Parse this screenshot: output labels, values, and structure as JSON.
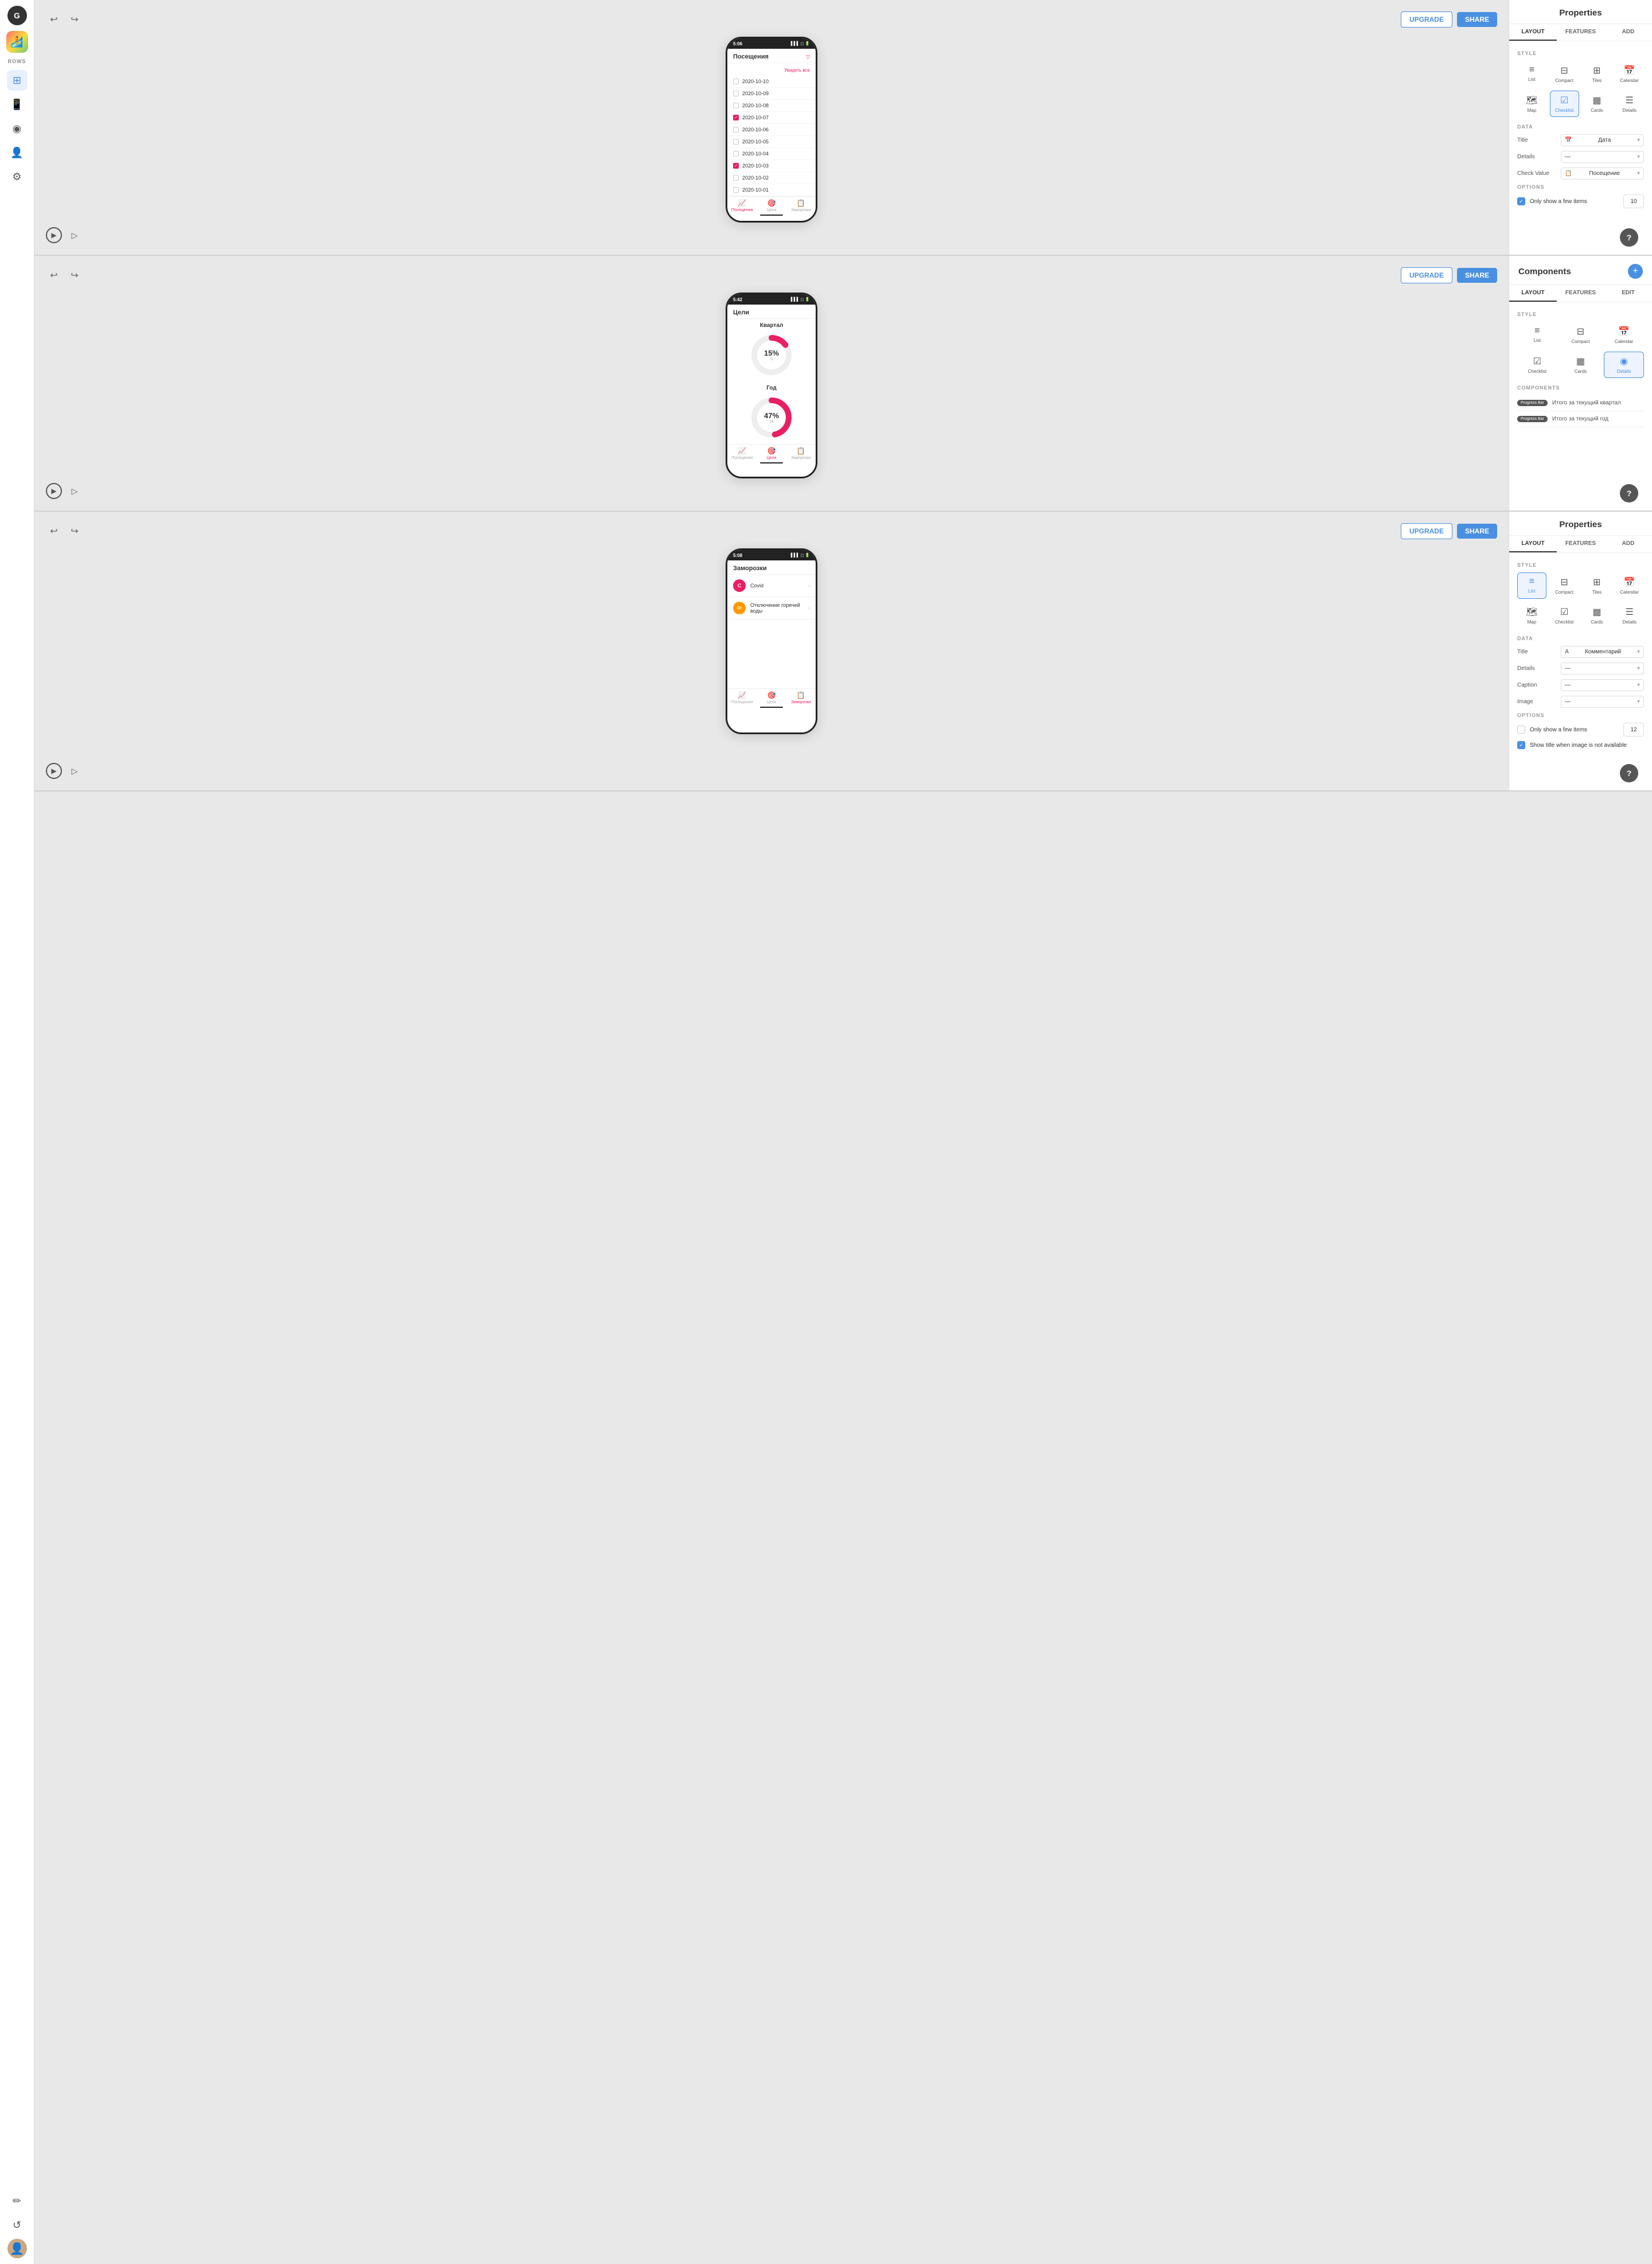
{
  "sidebar": {
    "avatar": "G",
    "app_icon": "🏄",
    "rows_label": "ROWS",
    "icons": [
      "⊞",
      "📱",
      "◉",
      "👤",
      "⚙",
      "✏",
      "↺"
    ],
    "user_icon": "👤"
  },
  "panel1": {
    "top_bar": {
      "undo": "↩",
      "redo": "↪",
      "upgrade": "UPGRADE",
      "share": "SHARE"
    },
    "phone": {
      "time": "5:06",
      "screen_title": "Посещения",
      "see_all": "Увидеть все",
      "filter_icon": "▽",
      "items": [
        {
          "date": "2020-10-10",
          "checked": false
        },
        {
          "date": "2020-10-09",
          "checked": false
        },
        {
          "date": "2020-10-08",
          "checked": false
        },
        {
          "date": "2020-10-07",
          "checked": true
        },
        {
          "date": "2020-10-06",
          "checked": false
        },
        {
          "date": "2020-10-05",
          "checked": false
        },
        {
          "date": "2020-10-04",
          "checked": false
        },
        {
          "date": "2020-10-03",
          "checked": true
        },
        {
          "date": "2020-10-02",
          "checked": false
        },
        {
          "date": "2020-10-01",
          "checked": false
        }
      ],
      "nav": [
        {
          "label": "Посещения",
          "icon": "📈",
          "active": true
        },
        {
          "label": "Цели",
          "icon": "🎯",
          "active": false
        },
        {
          "label": "Заморозки",
          "icon": "📋",
          "active": false
        }
      ]
    },
    "props": {
      "title": "Properties",
      "tabs": [
        "LAYOUT",
        "FEATURES",
        "ADD"
      ],
      "active_tab": "LAYOUT",
      "style_label": "STYLE",
      "styles": [
        {
          "icon": "≡",
          "label": "List"
        },
        {
          "icon": "⊟",
          "label": "Compact"
        },
        {
          "icon": "⊞",
          "label": "Tiles"
        },
        {
          "icon": "📅",
          "label": "Calendar"
        },
        {
          "icon": "🗺",
          "label": "Map"
        },
        {
          "icon": "☑",
          "label": "Checklist",
          "selected": true
        },
        {
          "icon": "▦",
          "label": "Cards"
        },
        {
          "icon": "☰",
          "label": "Details"
        }
      ],
      "data_label": "DATA",
      "fields": [
        {
          "label": "Title",
          "value": "Дата",
          "icon": "📅"
        },
        {
          "label": "Details",
          "value": "—"
        },
        {
          "label": "Check Value",
          "value": "Посещение",
          "icon": "📋"
        }
      ],
      "options_label": "OPTIONS",
      "only_show_few": {
        "label": "Only show a few items",
        "checked": true,
        "value": "10"
      }
    }
  },
  "panel2": {
    "top_bar": {
      "upgrade": "UPGRADE",
      "share": "SHARE"
    },
    "phone": {
      "time": "5:42",
      "screen_title": "Цели",
      "sections": [
        {
          "period": "Квартал",
          "pct": "15%",
          "num": "3",
          "arc": 15
        },
        {
          "period": "Год",
          "pct": "47%",
          "num": "24",
          "arc": 47
        }
      ],
      "nav": [
        {
          "label": "Посещения",
          "icon": "📈",
          "active": false
        },
        {
          "label": "Цели",
          "icon": "🎯",
          "active": true
        },
        {
          "label": "Заморозки",
          "icon": "📋",
          "active": false
        }
      ]
    },
    "props": {
      "title": "Components",
      "tabs": [
        "LAYOUT",
        "FEATURES",
        "EDIT"
      ],
      "active_tab": "LAYOUT",
      "style_label": "STYLE",
      "styles": [
        {
          "icon": "≡",
          "label": "List"
        },
        {
          "icon": "⊟",
          "label": "Compact"
        },
        {
          "icon": "📅",
          "label": "Calendar"
        },
        {
          "icon": "☑",
          "label": "Checklist"
        },
        {
          "icon": "▦",
          "label": "Cards"
        },
        {
          "icon": "◉",
          "label": "Details",
          "selected": true
        }
      ],
      "components_label": "COMPONENTS",
      "components": [
        {
          "pill": "Progress Bar",
          "text": "Итого за текущий квартал"
        },
        {
          "pill": "Progress Bar",
          "text": "Итого за текущий год"
        }
      ]
    }
  },
  "panel3": {
    "top_bar": {
      "upgrade": "UPGRADE",
      "share": "SHARE"
    },
    "phone": {
      "time": "5:08",
      "screen_title": "Заморозки",
      "items": [
        {
          "letter": "C",
          "color": "#e91e63",
          "text": "Covid"
        },
        {
          "letter": "Or",
          "color": "#ff9800",
          "text": "Отключение горячей воды"
        }
      ],
      "nav": [
        {
          "label": "Посещения",
          "icon": "📈",
          "active": false
        },
        {
          "label": "Цели",
          "icon": "🎯",
          "active": false
        },
        {
          "label": "Заморозки",
          "icon": "📋",
          "active": true
        }
      ]
    },
    "props": {
      "title": "Properties",
      "tabs": [
        "LAYOUT",
        "FEATURES",
        "ADD"
      ],
      "active_tab": "LAYOUT",
      "style_label": "STYLE",
      "styles": [
        {
          "icon": "≡",
          "label": "List",
          "selected": true
        },
        {
          "icon": "⊟",
          "label": "Compact"
        },
        {
          "icon": "⊞",
          "label": "Tiles"
        },
        {
          "icon": "📅",
          "label": "Calendar"
        },
        {
          "icon": "🗺",
          "label": "Map"
        },
        {
          "icon": "☑",
          "label": "Checklist"
        },
        {
          "icon": "▦",
          "label": "Cards"
        },
        {
          "icon": "☰",
          "label": "Details"
        }
      ],
      "data_label": "DATA",
      "fields": [
        {
          "label": "Title",
          "value": "Комментарий",
          "icon": "A"
        },
        {
          "label": "Details",
          "value": "—"
        },
        {
          "label": "Caption",
          "value": "—"
        },
        {
          "label": "Image",
          "value": "—"
        }
      ],
      "options_label": "OPTIONS",
      "only_show_few": {
        "label": "Only show a few items",
        "checked": false,
        "value": "12"
      },
      "show_title_no_image": {
        "label": "Show title when image is not available",
        "checked": true
      }
    }
  }
}
